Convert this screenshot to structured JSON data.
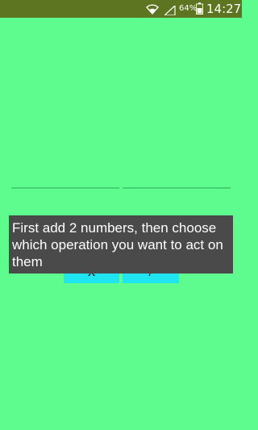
{
  "status_bar": {
    "battery_percent": "64%",
    "time": "14:27",
    "icons": [
      "wifi-icon",
      "signal-icon",
      "battery-icon"
    ]
  },
  "buttons": {
    "multiply_label": "x",
    "divide_label": "/"
  },
  "toast": {
    "message": "First add 2 numbers, then choose which operation you want to act on them"
  },
  "colors": {
    "background": "#5efb8e",
    "status_bar": "#5d7520",
    "button": "#1ee5ef",
    "toast": "#4a4a4a"
  }
}
